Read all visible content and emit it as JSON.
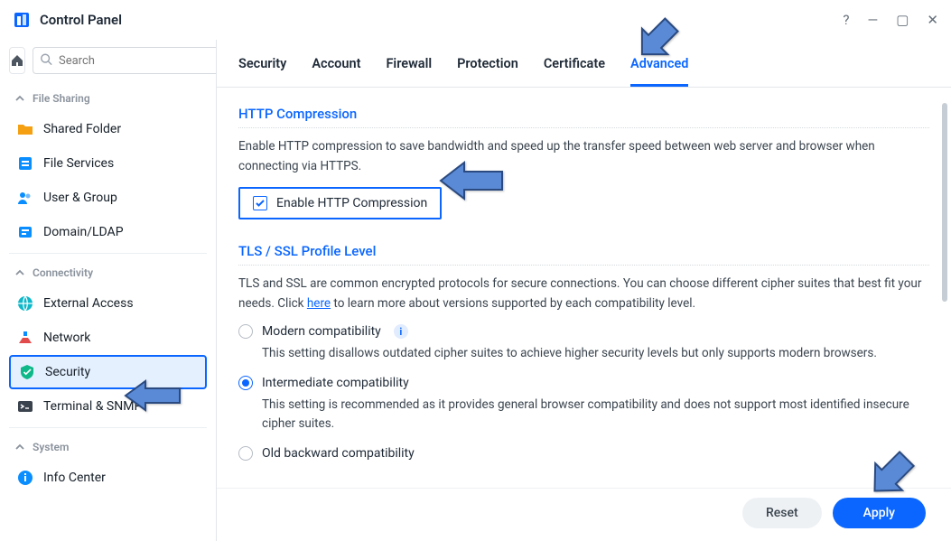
{
  "window": {
    "title": "Control Panel"
  },
  "sidebar": {
    "search_placeholder": "Search",
    "sections": {
      "file_sharing": "File Sharing",
      "connectivity": "Connectivity",
      "system": "System"
    },
    "items": {
      "shared_folder": "Shared Folder",
      "file_services": "File Services",
      "user_group": "User & Group",
      "domain_ldap": "Domain/LDAP",
      "external_access": "External Access",
      "network": "Network",
      "security": "Security",
      "terminal_snmp": "Terminal & SNMP",
      "info_center": "Info Center"
    }
  },
  "tabs": {
    "security": "Security",
    "account": "Account",
    "firewall": "Firewall",
    "protection": "Protection",
    "certificate": "Certificate",
    "advanced": "Advanced"
  },
  "content": {
    "http_group": "HTTP Compression",
    "http_desc": "Enable HTTP compression to save bandwidth and speed up the transfer speed between web server and browser when connecting via HTTPS.",
    "http_checkbox": "Enable HTTP Compression",
    "tls_group": "TLS / SSL Profile Level",
    "tls_desc_pre": "TLS and SSL are common encrypted protocols for secure connections. You can choose different cipher suites that best fit your needs. Click ",
    "tls_desc_link": "here",
    "tls_desc_post": " to learn more about versions supported by each compatibility level.",
    "radio_modern": "Modern compatibility",
    "radio_modern_desc": "This setting disallows outdated cipher suites to achieve higher security levels but only supports modern browsers.",
    "radio_intermediate": "Intermediate compatibility",
    "radio_intermediate_desc": "This setting is recommended as it provides general browser compatibility and does not support most identified insecure cipher suites.",
    "radio_old": "Old backward compatibility"
  },
  "footer": {
    "reset": "Reset",
    "apply": "Apply"
  }
}
